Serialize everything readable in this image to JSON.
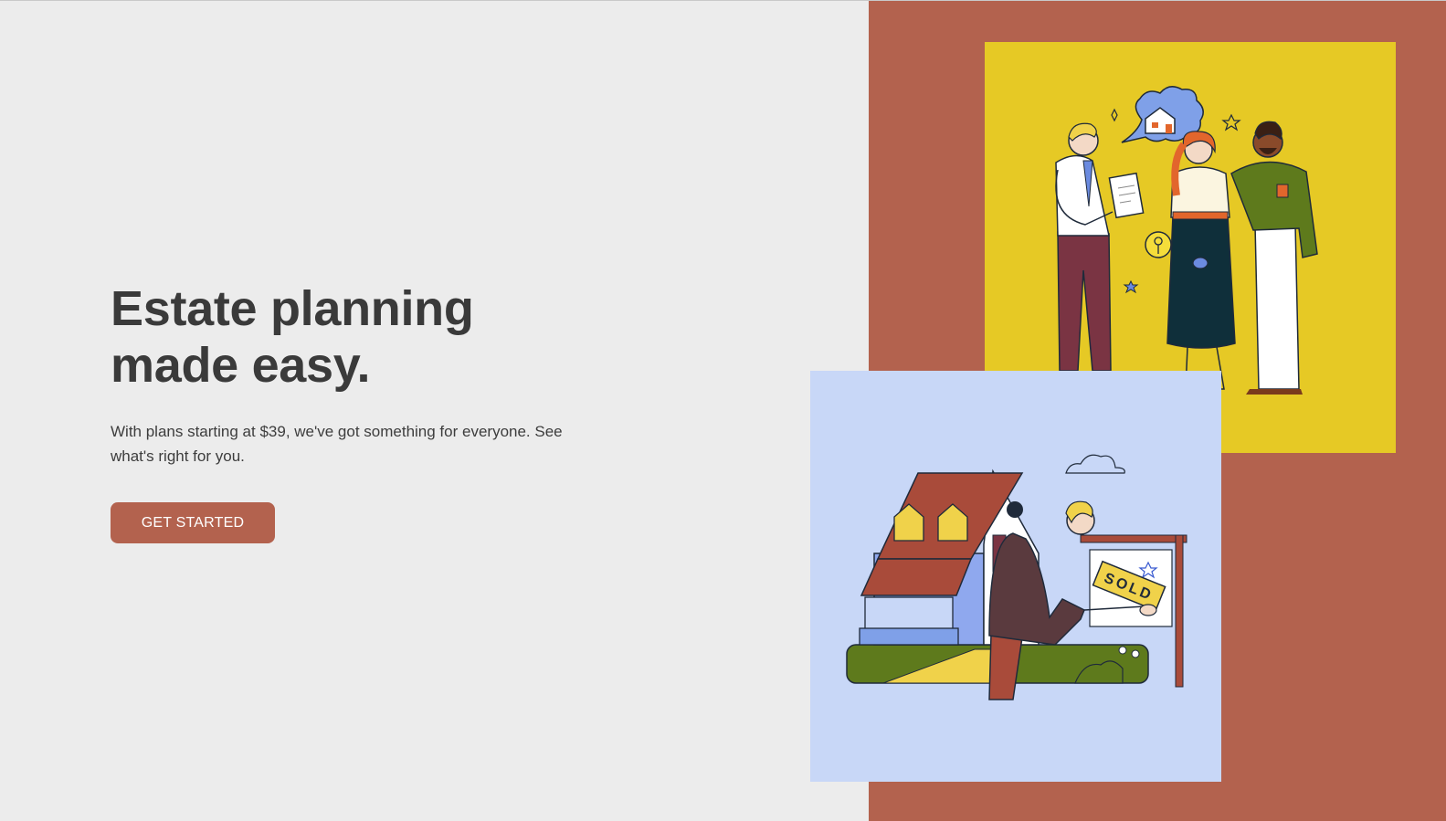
{
  "hero": {
    "headline_line1": "Estate planning",
    "headline_line2": "made easy.",
    "subtext": "With plans starting at $39, we've got something for everyone. See what's right for you.",
    "cta_label": "GET STARTED"
  },
  "illustrations": {
    "couple_scene_sign": "",
    "sold_sign_text": "SOLD"
  },
  "colors": {
    "page_background": "#ececec",
    "accent_terracotta": "#b3624e",
    "card_yellow": "#e6c925",
    "card_blue": "#c8d7f7",
    "text_dark": "#3a3a3a"
  }
}
